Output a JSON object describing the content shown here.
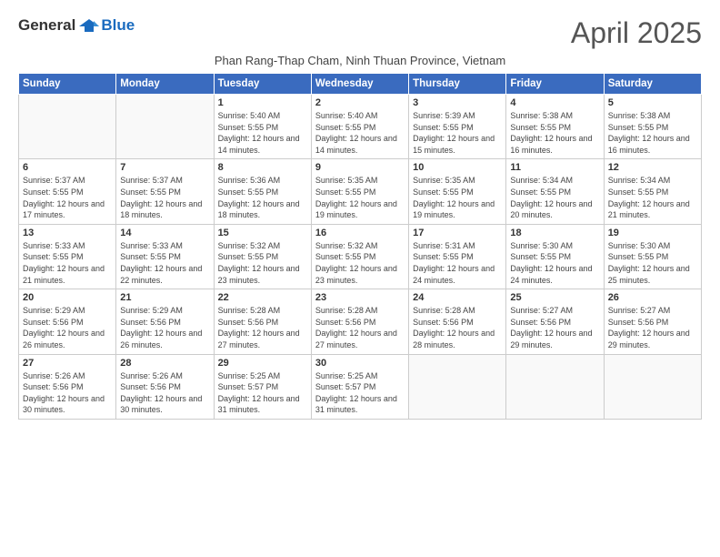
{
  "logo": {
    "general": "General",
    "blue": "Blue"
  },
  "title": "April 2025",
  "subtitle": "Phan Rang-Thap Cham, Ninh Thuan Province, Vietnam",
  "days": [
    "Sunday",
    "Monday",
    "Tuesday",
    "Wednesday",
    "Thursday",
    "Friday",
    "Saturday"
  ],
  "weeks": [
    [
      {
        "num": "",
        "info": ""
      },
      {
        "num": "",
        "info": ""
      },
      {
        "num": "1",
        "info": "Sunrise: 5:40 AM\nSunset: 5:55 PM\nDaylight: 12 hours and 14 minutes."
      },
      {
        "num": "2",
        "info": "Sunrise: 5:40 AM\nSunset: 5:55 PM\nDaylight: 12 hours and 14 minutes."
      },
      {
        "num": "3",
        "info": "Sunrise: 5:39 AM\nSunset: 5:55 PM\nDaylight: 12 hours and 15 minutes."
      },
      {
        "num": "4",
        "info": "Sunrise: 5:38 AM\nSunset: 5:55 PM\nDaylight: 12 hours and 16 minutes."
      },
      {
        "num": "5",
        "info": "Sunrise: 5:38 AM\nSunset: 5:55 PM\nDaylight: 12 hours and 16 minutes."
      }
    ],
    [
      {
        "num": "6",
        "info": "Sunrise: 5:37 AM\nSunset: 5:55 PM\nDaylight: 12 hours and 17 minutes."
      },
      {
        "num": "7",
        "info": "Sunrise: 5:37 AM\nSunset: 5:55 PM\nDaylight: 12 hours and 18 minutes."
      },
      {
        "num": "8",
        "info": "Sunrise: 5:36 AM\nSunset: 5:55 PM\nDaylight: 12 hours and 18 minutes."
      },
      {
        "num": "9",
        "info": "Sunrise: 5:35 AM\nSunset: 5:55 PM\nDaylight: 12 hours and 19 minutes."
      },
      {
        "num": "10",
        "info": "Sunrise: 5:35 AM\nSunset: 5:55 PM\nDaylight: 12 hours and 19 minutes."
      },
      {
        "num": "11",
        "info": "Sunrise: 5:34 AM\nSunset: 5:55 PM\nDaylight: 12 hours and 20 minutes."
      },
      {
        "num": "12",
        "info": "Sunrise: 5:34 AM\nSunset: 5:55 PM\nDaylight: 12 hours and 21 minutes."
      }
    ],
    [
      {
        "num": "13",
        "info": "Sunrise: 5:33 AM\nSunset: 5:55 PM\nDaylight: 12 hours and 21 minutes."
      },
      {
        "num": "14",
        "info": "Sunrise: 5:33 AM\nSunset: 5:55 PM\nDaylight: 12 hours and 22 minutes."
      },
      {
        "num": "15",
        "info": "Sunrise: 5:32 AM\nSunset: 5:55 PM\nDaylight: 12 hours and 23 minutes."
      },
      {
        "num": "16",
        "info": "Sunrise: 5:32 AM\nSunset: 5:55 PM\nDaylight: 12 hours and 23 minutes."
      },
      {
        "num": "17",
        "info": "Sunrise: 5:31 AM\nSunset: 5:55 PM\nDaylight: 12 hours and 24 minutes."
      },
      {
        "num": "18",
        "info": "Sunrise: 5:30 AM\nSunset: 5:55 PM\nDaylight: 12 hours and 24 minutes."
      },
      {
        "num": "19",
        "info": "Sunrise: 5:30 AM\nSunset: 5:55 PM\nDaylight: 12 hours and 25 minutes."
      }
    ],
    [
      {
        "num": "20",
        "info": "Sunrise: 5:29 AM\nSunset: 5:56 PM\nDaylight: 12 hours and 26 minutes."
      },
      {
        "num": "21",
        "info": "Sunrise: 5:29 AM\nSunset: 5:56 PM\nDaylight: 12 hours and 26 minutes."
      },
      {
        "num": "22",
        "info": "Sunrise: 5:28 AM\nSunset: 5:56 PM\nDaylight: 12 hours and 27 minutes."
      },
      {
        "num": "23",
        "info": "Sunrise: 5:28 AM\nSunset: 5:56 PM\nDaylight: 12 hours and 27 minutes."
      },
      {
        "num": "24",
        "info": "Sunrise: 5:28 AM\nSunset: 5:56 PM\nDaylight: 12 hours and 28 minutes."
      },
      {
        "num": "25",
        "info": "Sunrise: 5:27 AM\nSunset: 5:56 PM\nDaylight: 12 hours and 29 minutes."
      },
      {
        "num": "26",
        "info": "Sunrise: 5:27 AM\nSunset: 5:56 PM\nDaylight: 12 hours and 29 minutes."
      }
    ],
    [
      {
        "num": "27",
        "info": "Sunrise: 5:26 AM\nSunset: 5:56 PM\nDaylight: 12 hours and 30 minutes."
      },
      {
        "num": "28",
        "info": "Sunrise: 5:26 AM\nSunset: 5:56 PM\nDaylight: 12 hours and 30 minutes."
      },
      {
        "num": "29",
        "info": "Sunrise: 5:25 AM\nSunset: 5:57 PM\nDaylight: 12 hours and 31 minutes."
      },
      {
        "num": "30",
        "info": "Sunrise: 5:25 AM\nSunset: 5:57 PM\nDaylight: 12 hours and 31 minutes."
      },
      {
        "num": "",
        "info": ""
      },
      {
        "num": "",
        "info": ""
      },
      {
        "num": "",
        "info": ""
      }
    ]
  ]
}
